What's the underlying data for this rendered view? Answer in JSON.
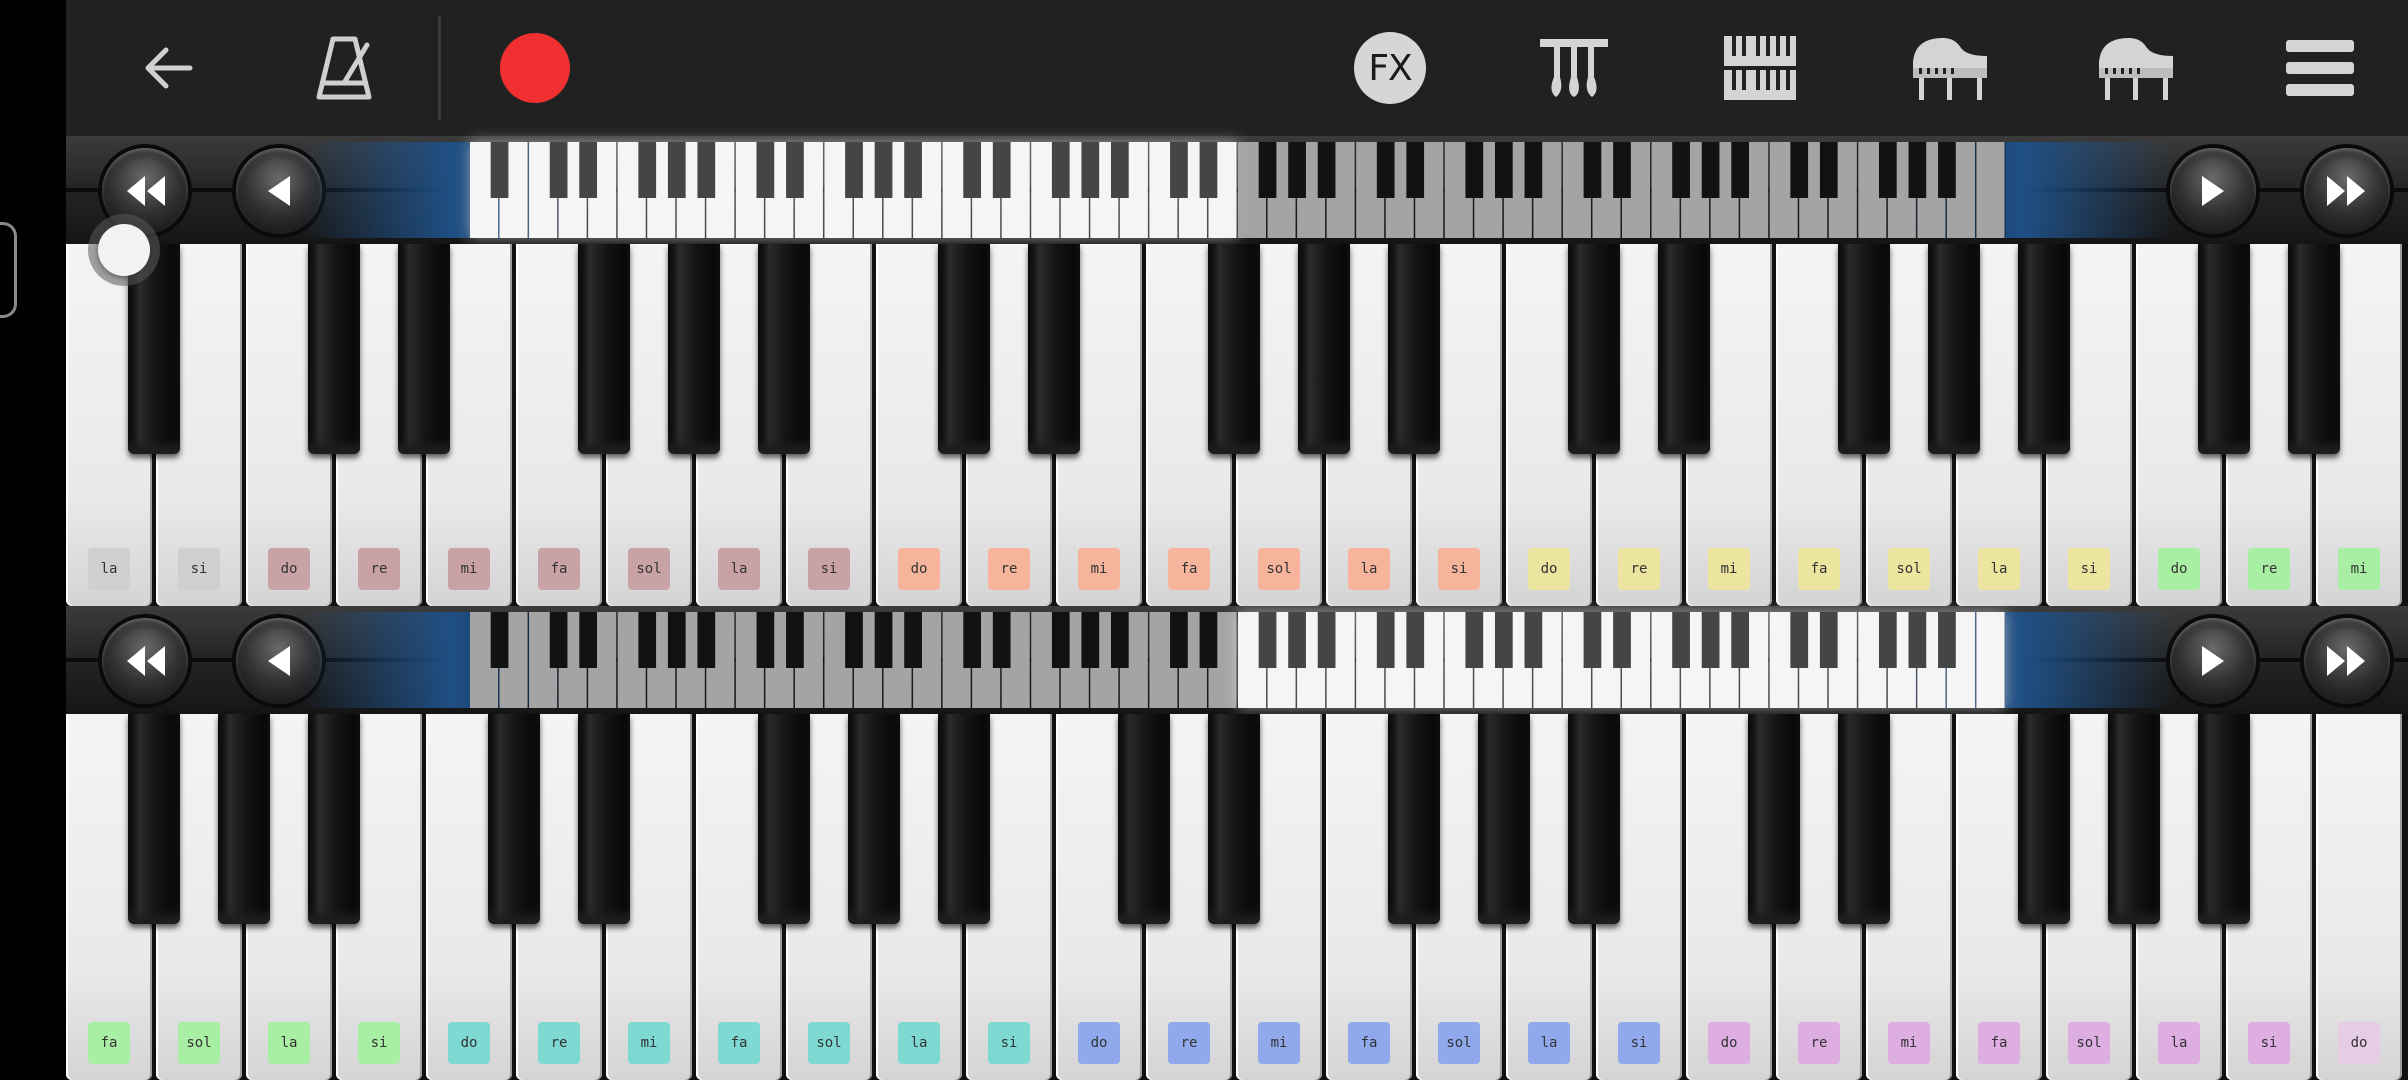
{
  "toolbar": {
    "icons": [
      "back-arrow-icon",
      "metronome-icon",
      "record-icon",
      "fx-icon",
      "pi-tuning-icon",
      "keyboard-layout-icon",
      "grand-piano-icon",
      "grand-piano-icon",
      "hamburger-menu-icon"
    ],
    "fx_label": "FX",
    "record_color": "#f03030"
  },
  "navigators": [
    {
      "position": "top",
      "highlighted_half": "left",
      "buttons": [
        "rewind-icon",
        "prev-icon",
        "play-icon",
        "fast-forward-icon"
      ]
    },
    {
      "position": "bottom",
      "highlighted_half": "right",
      "buttons": [
        "rewind-icon",
        "prev-icon",
        "play-icon",
        "fast-forward-icon"
      ]
    }
  ],
  "keyboards": [
    {
      "name": "upper",
      "keys": [
        {
          "label": "la",
          "color": "#cfcfcf"
        },
        {
          "label": "si",
          "color": "#cfcfcf"
        },
        {
          "label": "do",
          "color": "#c9a2a6"
        },
        {
          "label": "re",
          "color": "#c9a2a6"
        },
        {
          "label": "mi",
          "color": "#c9a2a6"
        },
        {
          "label": "fa",
          "color": "#c9a2a6"
        },
        {
          "label": "sol",
          "color": "#c9a2a6"
        },
        {
          "label": "la",
          "color": "#c9a2a6"
        },
        {
          "label": "si",
          "color": "#c9a2a6"
        },
        {
          "label": "do",
          "color": "#f5b49b"
        },
        {
          "label": "re",
          "color": "#f5b49b"
        },
        {
          "label": "mi",
          "color": "#f5b49b"
        },
        {
          "label": "fa",
          "color": "#f5b49b"
        },
        {
          "label": "sol",
          "color": "#f5b49b"
        },
        {
          "label": "la",
          "color": "#f5b49b"
        },
        {
          "label": "si",
          "color": "#f5b49b"
        },
        {
          "label": "do",
          "color": "#ece59f"
        },
        {
          "label": "re",
          "color": "#ece59f"
        },
        {
          "label": "mi",
          "color": "#ece59f"
        },
        {
          "label": "fa",
          "color": "#ece59f"
        },
        {
          "label": "sol",
          "color": "#ece59f"
        },
        {
          "label": "la",
          "color": "#ece59f"
        },
        {
          "label": "si",
          "color": "#ece59f"
        },
        {
          "label": "do",
          "color": "#a9efa3"
        },
        {
          "label": "re",
          "color": "#a9efa3"
        },
        {
          "label": "mi",
          "color": "#a9efa3"
        }
      ],
      "black_after_white_index": [
        0,
        2,
        3,
        5,
        6,
        7,
        9,
        10,
        12,
        13,
        14,
        16,
        17,
        19,
        20,
        21,
        23,
        24
      ]
    },
    {
      "name": "lower",
      "keys": [
        {
          "label": "fa",
          "color": "#a9efa3"
        },
        {
          "label": "sol",
          "color": "#a9efa3"
        },
        {
          "label": "la",
          "color": "#a9efa3"
        },
        {
          "label": "si",
          "color": "#a9efa3"
        },
        {
          "label": "do",
          "color": "#7fd9d3"
        },
        {
          "label": "re",
          "color": "#7fd9d3"
        },
        {
          "label": "mi",
          "color": "#7fd9d3"
        },
        {
          "label": "fa",
          "color": "#7fd9d3"
        },
        {
          "label": "sol",
          "color": "#7fd9d3"
        },
        {
          "label": "la",
          "color": "#7fd9d3"
        },
        {
          "label": "si",
          "color": "#7fd9d3"
        },
        {
          "label": "do",
          "color": "#8fa9ec"
        },
        {
          "label": "re",
          "color": "#8fa9ec"
        },
        {
          "label": "mi",
          "color": "#8fa9ec"
        },
        {
          "label": "fa",
          "color": "#8fa9ec"
        },
        {
          "label": "sol",
          "color": "#8fa9ec"
        },
        {
          "label": "la",
          "color": "#8fa9ec"
        },
        {
          "label": "si",
          "color": "#8fa9ec"
        },
        {
          "label": "do",
          "color": "#deaee3"
        },
        {
          "label": "re",
          "color": "#deaee3"
        },
        {
          "label": "mi",
          "color": "#deaee3"
        },
        {
          "label": "fa",
          "color": "#deaee3"
        },
        {
          "label": "sol",
          "color": "#deaee3"
        },
        {
          "label": "la",
          "color": "#deaee3"
        },
        {
          "label": "si",
          "color": "#deaee3"
        },
        {
          "label": "do",
          "color": "#e6cde6"
        }
      ],
      "black_after_white_index": [
        0,
        1,
        2,
        4,
        5,
        7,
        8,
        9,
        11,
        12,
        14,
        15,
        16,
        18,
        19,
        21,
        22,
        23
      ]
    }
  ]
}
